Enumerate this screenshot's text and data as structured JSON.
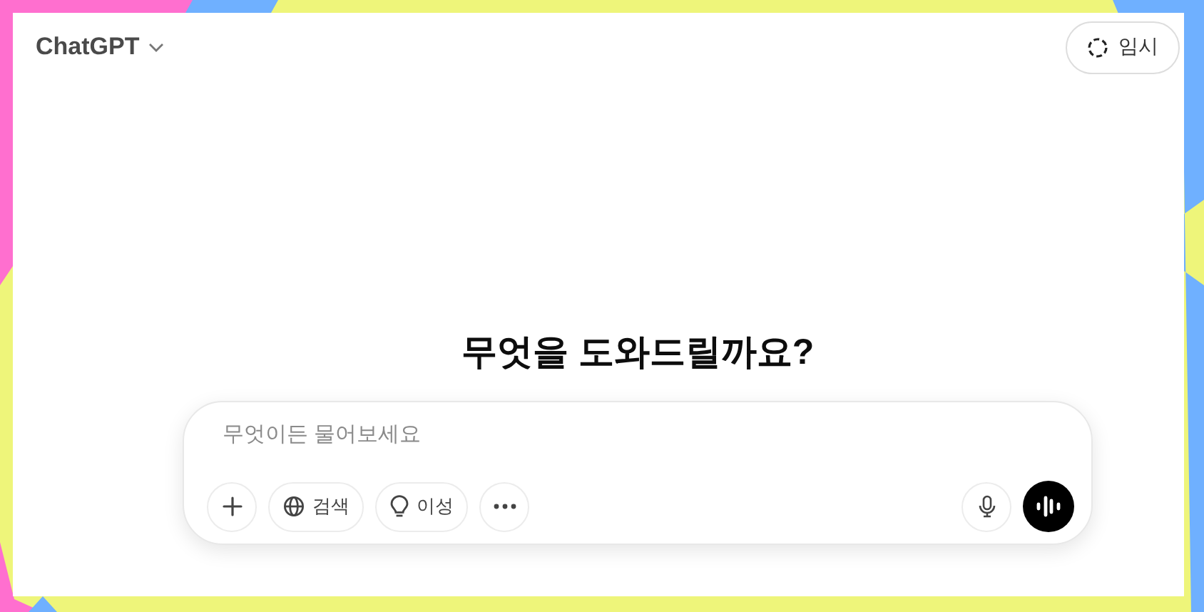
{
  "header": {
    "model": "ChatGPT",
    "temporary_button": "임시"
  },
  "heading": "무엇을 도와드릴까요?",
  "composer": {
    "placeholder": "무엇이든 물어보세요",
    "tools": [
      {
        "kind": "plus"
      },
      {
        "kind": "search",
        "label": "검색"
      },
      {
        "kind": "reason",
        "label": "이성"
      },
      {
        "kind": "more"
      }
    ]
  }
}
